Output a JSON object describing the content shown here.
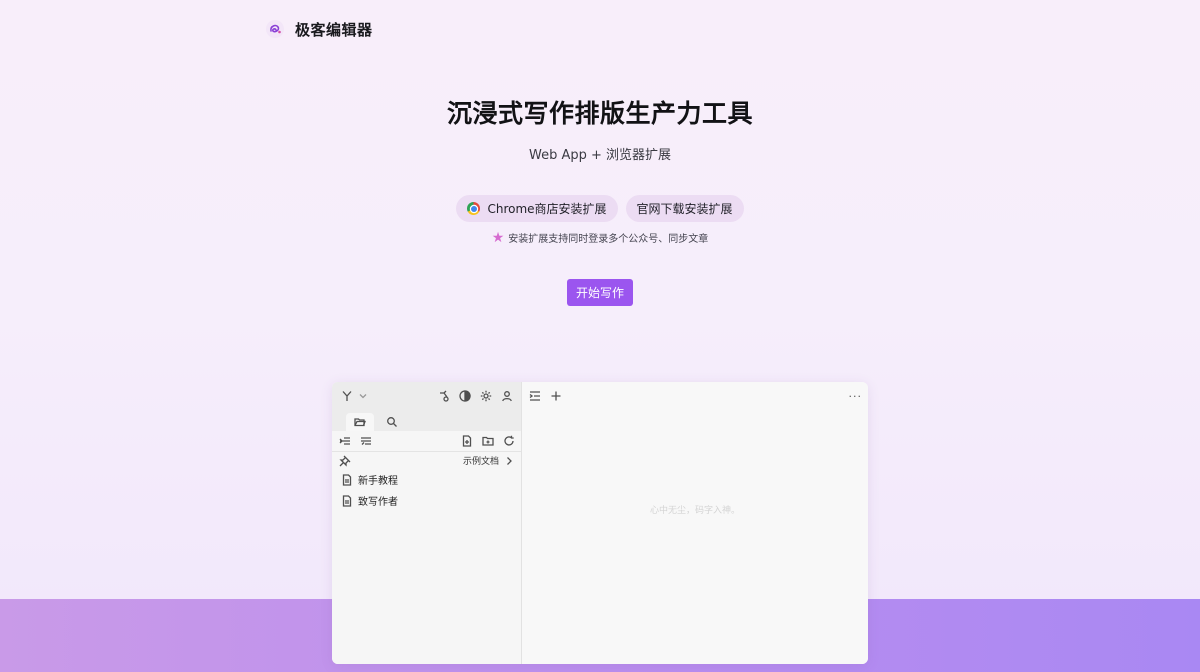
{
  "header": {
    "brand": "极客编辑器",
    "logo_icon": "swirl-logo-icon",
    "accent": "#9b55ef"
  },
  "hero": {
    "title": "沉浸式写作排版生产力工具",
    "subtitle": "Web App + 浏览器扩展",
    "chrome_button": "Chrome商店安装扩展",
    "official_button": "官网下载安装扩展",
    "note": "安装扩展支持同时登录多个公众号、同步文章",
    "start_button": "开始写作"
  },
  "app": {
    "branch_label": "Y",
    "sample_docs": "示例文档",
    "files": [
      "新手教程",
      "致写作者"
    ],
    "placeholder": "心中无尘，码字入神。",
    "more": "···"
  }
}
